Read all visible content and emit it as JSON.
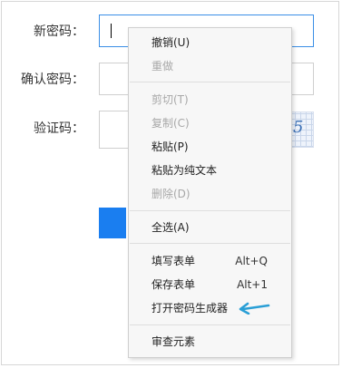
{
  "form": {
    "new_password_label": "新密码：",
    "confirm_password_label": "确认密码：",
    "captcha_label": "验证码：",
    "captcha_char": "5"
  },
  "context_menu": {
    "undo": "撤销(U)",
    "redo": "重做",
    "cut": "剪切(T)",
    "copy": "复制(C)",
    "paste": "粘贴(P)",
    "paste_plain": "粘贴为纯文本",
    "delete": "删除(D)",
    "select_all": "全选(A)",
    "fill_form": "填写表单",
    "fill_form_shortcut": "Alt+Q",
    "save_form": "保存表单",
    "save_form_shortcut": "Alt+1",
    "password_generator": "打开密码生成器",
    "inspect": "审查元素"
  },
  "colors": {
    "accent": "#1a7ef0",
    "arrow": "#2a9fd6",
    "focus_border": "#3a8ee6"
  }
}
